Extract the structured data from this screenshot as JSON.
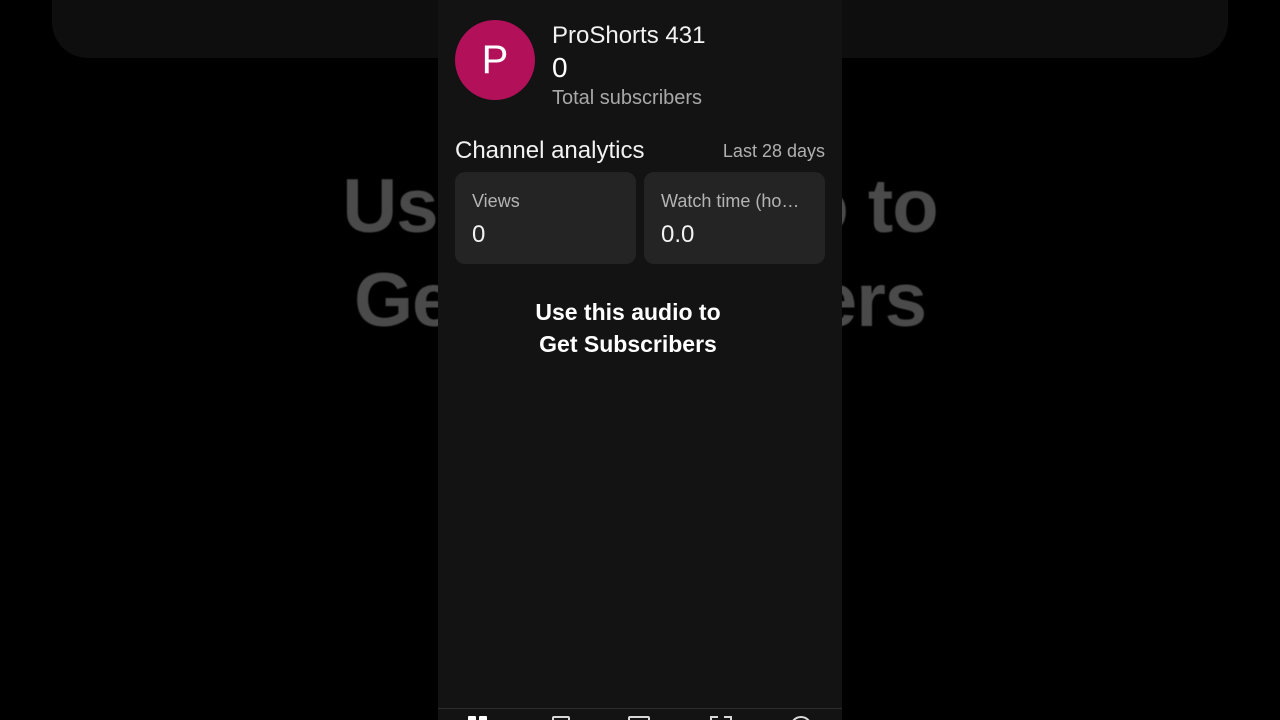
{
  "background": {
    "caption_line1": "Use this audio to",
    "caption_line2": "Get Subscribers"
  },
  "channel": {
    "avatar_letter": "P",
    "avatar_color": "#b3105a",
    "name": "ProShorts 431",
    "subscriber_count": "0",
    "subscriber_label": "Total subscribers"
  },
  "analytics": {
    "title": "Channel analytics",
    "period": "Last 28 days",
    "cards": [
      {
        "label": "Views",
        "value": "0"
      },
      {
        "label": "Watch time (hours)",
        "value": "0.0"
      }
    ]
  },
  "overlay_caption": {
    "line1": "Use this audio to",
    "line2": "Get Subscribers"
  },
  "bottom_nav": {
    "items": [
      {
        "icon": "dashboard-icon"
      },
      {
        "icon": "content-icon"
      },
      {
        "icon": "analytics-icon"
      },
      {
        "icon": "comments-icon"
      },
      {
        "icon": "earn-icon"
      }
    ]
  }
}
